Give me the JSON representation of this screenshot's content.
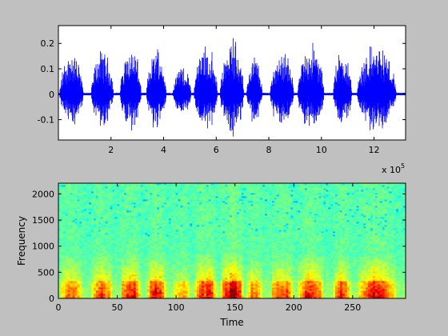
{
  "chart_data": [
    {
      "type": "line",
      "title": "",
      "xlabel": "",
      "ylabel": "",
      "x_multiplier_label": "x 10",
      "x_multiplier_exponent": "5",
      "xlim": [
        0,
        132000
      ],
      "ylim": [
        -0.18,
        0.27
      ],
      "xticks": [
        20000,
        40000,
        60000,
        80000,
        100000,
        120000
      ],
      "xtick_labels": [
        "2",
        "4",
        "6",
        "8",
        "10",
        "12"
      ],
      "yticks": [
        -0.1,
        0,
        0.1,
        0.2
      ],
      "ytick_labels": [
        "-0.1",
        "0",
        "0.1",
        "0.2"
      ],
      "grid": false,
      "series_color": "#0000ff",
      "bursts": [
        {
          "x": [
            500,
            9500
          ],
          "amp": 0.18
        },
        {
          "x": [
            12500,
            21000
          ],
          "amp": 0.19
        },
        {
          "x": [
            23500,
            31500
          ],
          "amp": 0.22
        },
        {
          "x": [
            33500,
            41000
          ],
          "amp": 0.21
        },
        {
          "x": [
            43500,
            50500
          ],
          "amp": 0.13
        },
        {
          "x": [
            51500,
            60500
          ],
          "amp": 0.22
        },
        {
          "x": [
            61500,
            70500
          ],
          "amp": 0.26
        },
        {
          "x": [
            71500,
            77500
          ],
          "amp": 0.17
        },
        {
          "x": [
            80500,
            89500
          ],
          "amp": 0.2
        },
        {
          "x": [
            91000,
            101000
          ],
          "amp": 0.22
        },
        {
          "x": [
            104500,
            111500
          ],
          "amp": 0.2
        },
        {
          "x": [
            113500,
            128500
          ],
          "amp": 0.22
        }
      ]
    },
    {
      "type": "heatmap",
      "title": "",
      "xlabel": "Time",
      "ylabel": "Frequency",
      "xlim": [
        0,
        295
      ],
      "ylim": [
        0,
        2205
      ],
      "xticks": [
        0,
        50,
        100,
        150,
        200,
        250
      ],
      "xtick_labels": [
        "0",
        "50",
        "100",
        "150",
        "200",
        "250"
      ],
      "yticks": [
        0,
        500,
        1000,
        1500,
        2000
      ],
      "ytick_labels": [
        "0",
        "500",
        "1000",
        "1500",
        "2000"
      ],
      "colormap": "jet",
      "grid": false,
      "energy_profile": "high energy (red/yellow) concentrated below ~700 Hz in bursts over time; green/cyan noise floor above"
    }
  ]
}
